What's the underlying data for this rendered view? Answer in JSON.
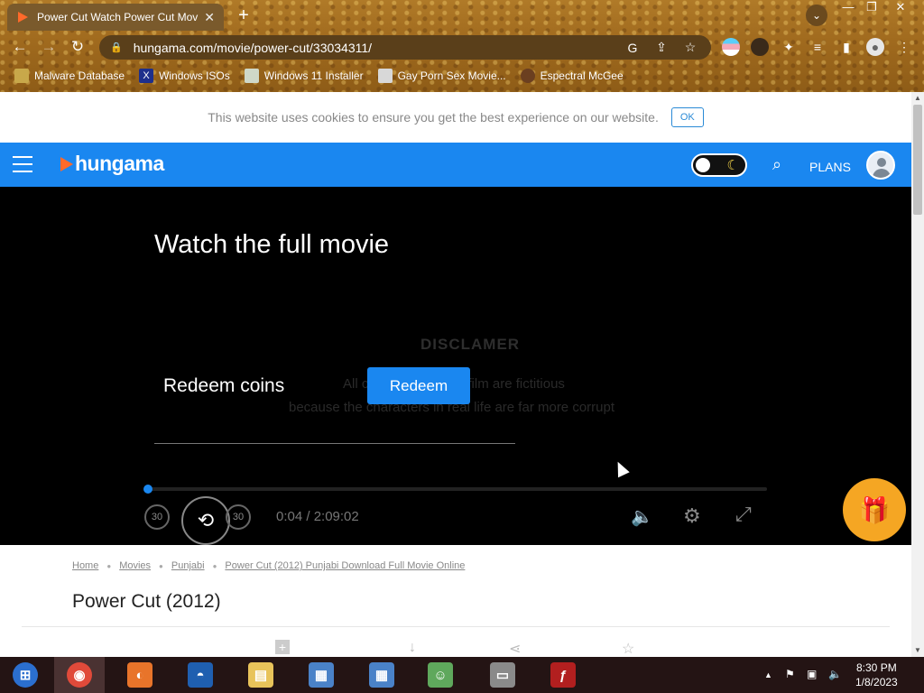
{
  "browser": {
    "tab_title": "Power Cut Watch Power Cut Movie",
    "tab_close": "✕",
    "new_tab": "+",
    "tab_search": "⌄",
    "window_buttons": {
      "minimize": "—",
      "restore": "❐",
      "close": "✕"
    },
    "nav": {
      "back": "←",
      "forward": "→",
      "reload": "↻"
    },
    "url": "hungama.com/movie/power-cut/33034311/",
    "omnibox_icons": {
      "google": "G",
      "share": "⇪",
      "star": "☆"
    },
    "toolbar_icons": {
      "extensions": "✦",
      "reading_list": "≡",
      "side_panel": "▮",
      "menu": "⋮"
    },
    "bookmarks": [
      {
        "label": "Malware Database",
        "icon": "folder-icon",
        "icon_color": "#c8a84a"
      },
      {
        "label": "Windows ISOs",
        "icon": "x-icon",
        "icon_color": "#1d2f8c"
      },
      {
        "label": "Windows 11 Installer",
        "icon": "image-icon",
        "icon_color": "#cfd8c8"
      },
      {
        "label": "Gay Porn Sex Movie...",
        "icon": "globe-icon",
        "icon_color": "#d8d8d8"
      },
      {
        "label": "Espectral McGee",
        "icon": "avatar-icon",
        "icon_color": "#6b3f20"
      }
    ]
  },
  "page": {
    "cookie_text": "This website uses cookies to ensure you get the best experience on our website.",
    "cookie_ok": "OK",
    "brand": "hungama",
    "plans": "PLANS",
    "player": {
      "heading": "Watch the full movie",
      "disclaimer_title": "DISCLAMER",
      "disclaimer_line1": "All characters in this film are fictitious",
      "disclaimer_line2": "because the characters in real life are far more corrupt",
      "redeem_label": "Redeem coins",
      "redeem_button": "Redeem",
      "time": "0:04 / 2:09:02",
      "progress_fraction": 0.0005,
      "rewind_label": "30",
      "forward_label": "30"
    },
    "breadcrumb": [
      "Home",
      "Movies",
      "Punjabi",
      "Power Cut (2012) Punjabi Download Full Movie Online"
    ],
    "title": "Power Cut (2012)"
  },
  "taskbar": {
    "apps": [
      {
        "name": "start-button",
        "color": "#2b6fcf",
        "glyph": "⊞"
      },
      {
        "name": "chrome",
        "color": "#e04a3a",
        "glyph": "◉",
        "active": true
      },
      {
        "name": "firefox",
        "color": "#e8742a",
        "glyph": "◐"
      },
      {
        "name": "obama",
        "color": "#1f5fb0",
        "glyph": "◓"
      },
      {
        "name": "file-explorer",
        "color": "#e8c35a",
        "glyph": "▤"
      },
      {
        "name": "network-setup",
        "color": "#4a82c8",
        "glyph": "▦"
      },
      {
        "name": "network-setup-2",
        "color": "#4a82c8",
        "glyph": "▦"
      },
      {
        "name": "messenger",
        "color": "#5fa85c",
        "glyph": "☺"
      },
      {
        "name": "archive",
        "color": "#8a8a8a",
        "glyph": "▭"
      },
      {
        "name": "flash-player",
        "color": "#b21f1f",
        "glyph": "ƒ"
      }
    ],
    "tray": {
      "chevron": "▲",
      "flag": "⚑",
      "network": "▣",
      "volume": "🔈"
    },
    "time": "8:30 PM",
    "date": "1/8/2023"
  }
}
